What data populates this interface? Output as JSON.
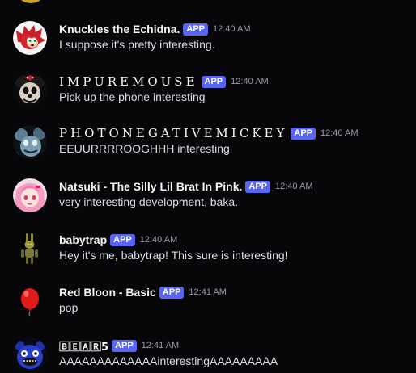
{
  "messages": [
    {
      "author": "Knuckles the Echidna.",
      "badge": "APP",
      "time": "12:40 AM",
      "text": "I suppose it's pretty interesting."
    },
    {
      "author": "IMPUREMOUSE",
      "badge": "APP",
      "time": "12:40 AM",
      "text": "Pick up the phone interesting"
    },
    {
      "author": "PHOTONEGATIVEMICKEY",
      "badge": "APP",
      "time": "12:40 AM",
      "text": "EEUURRRROOGHHH interesting"
    },
    {
      "author": "Natsuki - The Silly Lil Brat In Pink.",
      "badge": "APP",
      "time": "12:40 AM",
      "text": "very interesting development, baka."
    },
    {
      "author": "babytrap",
      "badge": "APP",
      "time": "12:40 AM",
      "text": "Hey it's me, babytrap! This sure is interesting!"
    },
    {
      "author": "Red Bloon - Basic",
      "badge": "APP",
      "time": "12:41 AM",
      "text": "pop"
    },
    {
      "author": "🄱🄴🄰🅁5",
      "badge": "APP",
      "time": "12:41 AM",
      "text": "AAAAAAAAAAAAAinterestingAAAAAAAAA"
    }
  ],
  "colors": {
    "background": "#070709",
    "badge": "#5865f2",
    "name": "#f2f3f5",
    "text": "#dbdee1",
    "timestamp": "#949ba4"
  }
}
